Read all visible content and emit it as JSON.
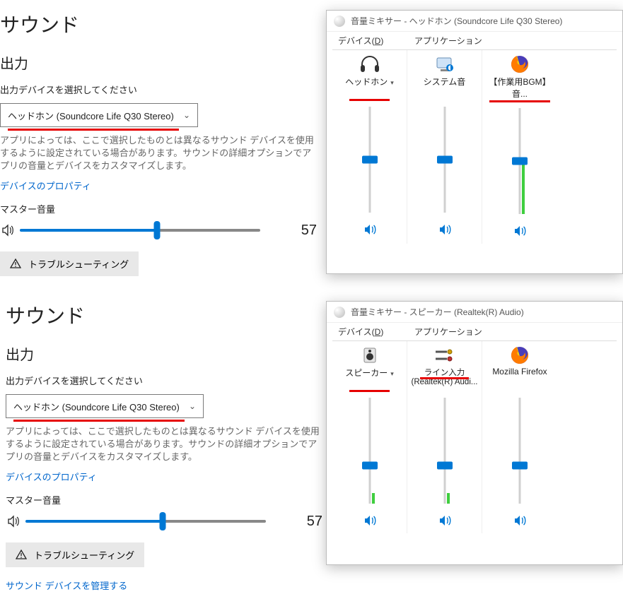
{
  "settings1": {
    "title": "サウンド",
    "section": "出力",
    "selectLabel": "出力デバイスを選択してください",
    "dropdownValue": "ヘッドホン (Soundcore Life Q30 Stereo)",
    "helpText": "アプリによっては、ここで選択したものとは異なるサウンド デバイスを使用するように設定されている場合があります。サウンドの詳細オプションでアプリの音量とデバイスをカスタマイズします。",
    "devicePropsLink": "デバイスのプロパティ",
    "masterVolumeLabel": "マスター音量",
    "masterVolumeValue": "57",
    "troubleshootBtn": "トラブルシューティング"
  },
  "settings2": {
    "title": "サウンド",
    "section": "出力",
    "selectLabel": "出力デバイスを選択してください",
    "dropdownValue": "ヘッドホン (Soundcore Life Q30 Stereo)",
    "helpText": "アプリによっては、ここで選択したものとは異なるサウンド デバイスを使用するように設定されている場合があります。サウンドの詳細オプションでアプリの音量とデバイスをカスタマイズします。",
    "devicePropsLink": "デバイスのプロパティ",
    "masterVolumeLabel": "マスター音量",
    "masterVolumeValue": "57",
    "troubleshootBtn": "トラブルシューティング",
    "manageDevicesLink": "サウンド デバイスを管理する"
  },
  "mixer1": {
    "windowTitle": "音量ミキサー - ヘッドホン (Soundcore Life Q30 Stereo)",
    "deviceLabelPre": "デバイス(",
    "deviceLabelU": "D",
    "deviceLabelPost": ")",
    "appLabel": "アプリケーション",
    "dev": {
      "name": "ヘッドホン",
      "sliderPct": 50,
      "level": 0
    },
    "apps": [
      {
        "name": "システム音",
        "sliderPct": 50,
        "level": 0
      },
      {
        "name": "【作業用BGM】音...",
        "sliderPct": 50,
        "level": 50,
        "red": true,
        "icon": "firefox"
      }
    ]
  },
  "mixer2": {
    "windowTitle": "音量ミキサー - スピーカー (Realtek(R) Audio)",
    "deviceLabelPre": "デバイス(",
    "deviceLabelU": "D",
    "deviceLabelPost": ")",
    "appLabel": "アプリケーション",
    "dev": {
      "name": "スピーカー",
      "sliderPct": 36,
      "level": 10
    },
    "apps": [
      {
        "name": "ライン入力 (Realtek(R) Audi...",
        "sliderPct": 36,
        "level": 10,
        "red": true,
        "icon": "linein"
      },
      {
        "name": "Mozilla Firefox",
        "sliderPct": 36,
        "level": 0,
        "icon": "firefox"
      }
    ]
  }
}
